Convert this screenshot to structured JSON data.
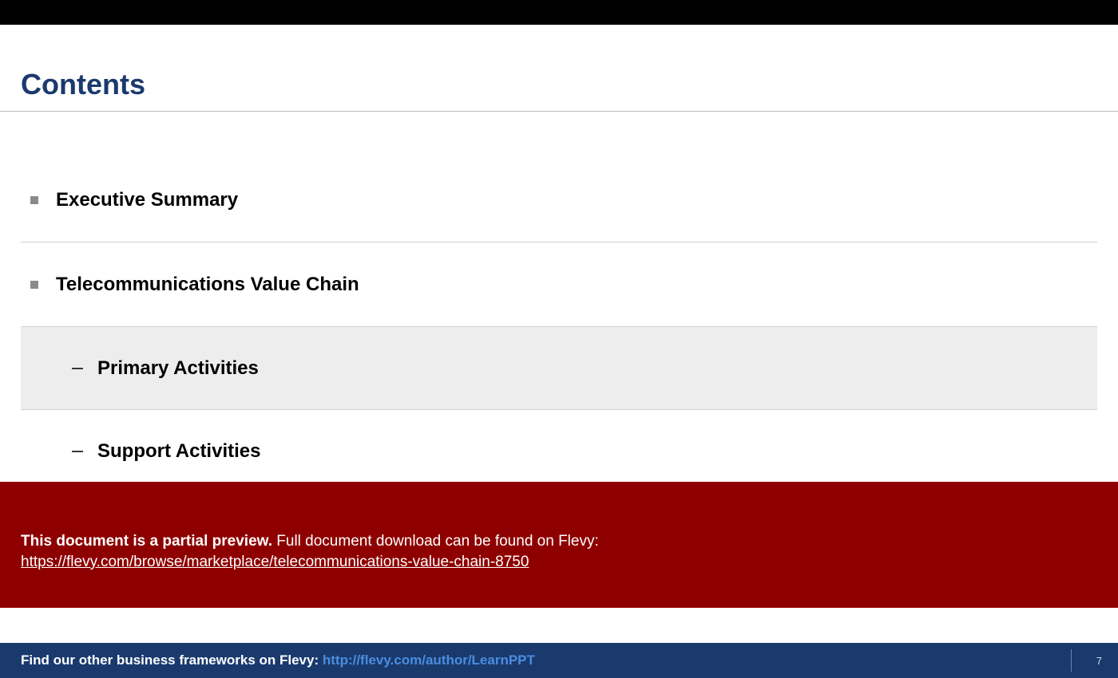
{
  "title": "Contents",
  "toc": [
    {
      "level": 1,
      "label": "Executive Summary",
      "highlight": false
    },
    {
      "level": 1,
      "label": "Telecommunications Value Chain",
      "highlight": false
    },
    {
      "level": 2,
      "label": "Primary Activities",
      "highlight": true
    },
    {
      "level": 2,
      "label": "Support Activities",
      "highlight": false
    }
  ],
  "preview": {
    "bold": "This document is a partial preview.",
    "rest": "  Full document download can be found on Flevy:",
    "url": "https://flevy.com/browse/marketplace/telecommunications-value-chain-8750"
  },
  "footer": {
    "text": "Find our other business frameworks on Flevy: ",
    "link": "http://flevy.com/author/LearnPPT",
    "page": "7"
  }
}
